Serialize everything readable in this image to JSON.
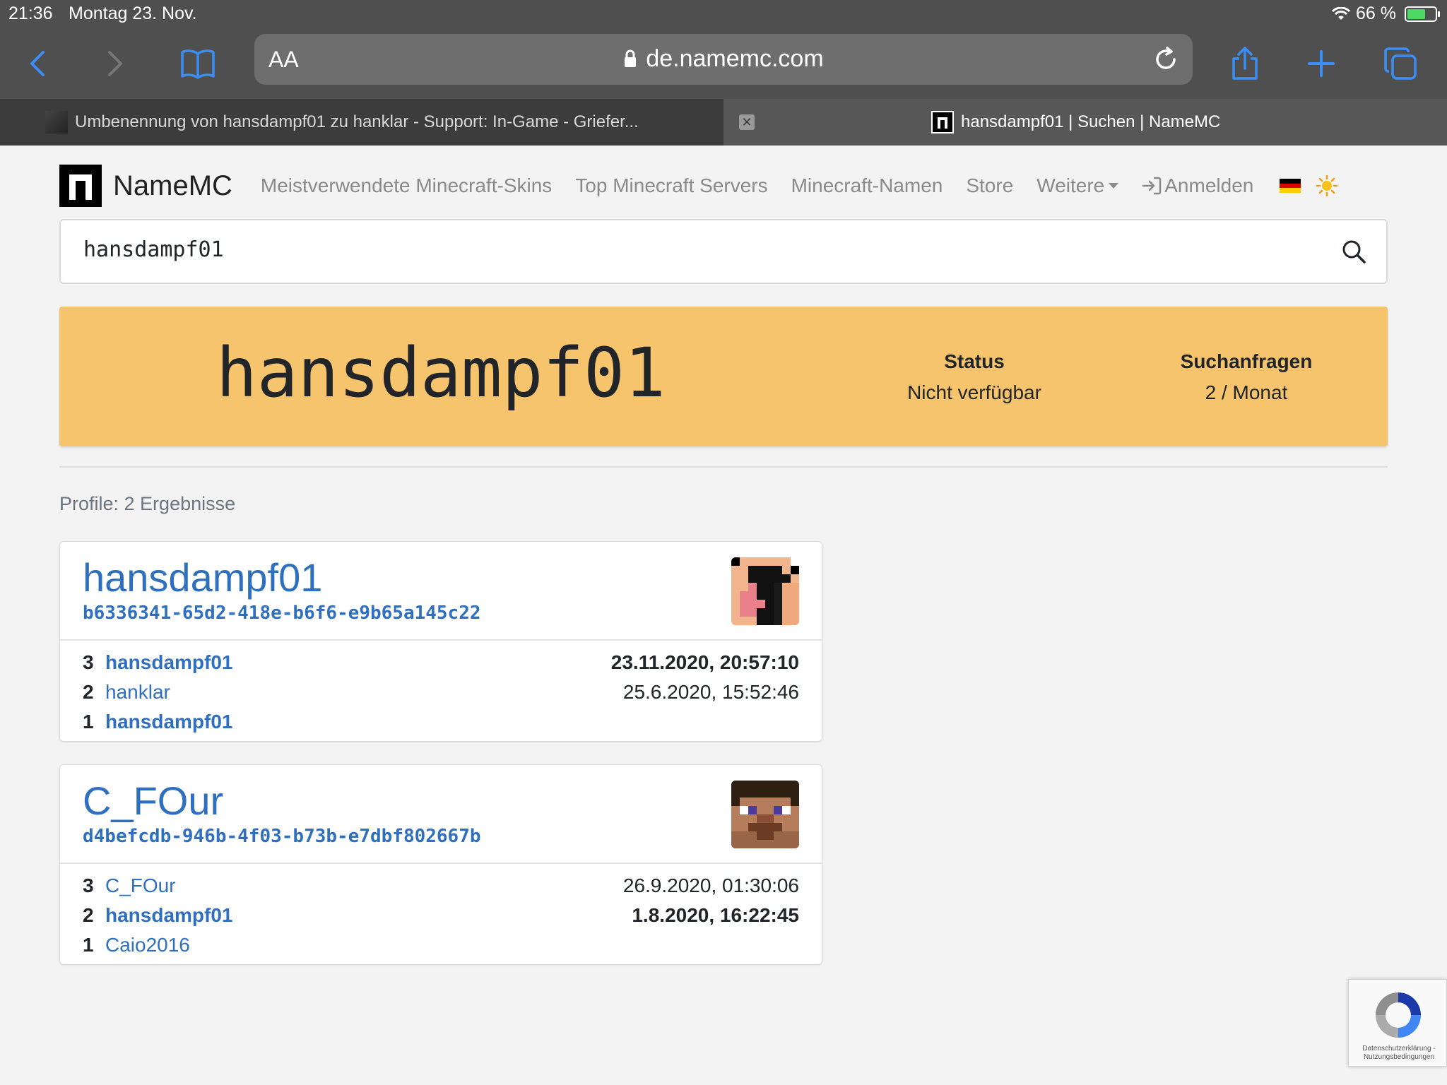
{
  "status_bar": {
    "time": "21:36",
    "date": "Montag 23. Nov.",
    "battery": "66 %"
  },
  "browser": {
    "text_size_label": "AA",
    "url": "de.namemc.com",
    "tabs": [
      {
        "title": "Umbenennung von hansdampf01 zu hanklar - Support: In-Game - Griefer..."
      },
      {
        "title": "hansdampf01 | Suchen | NameMC"
      }
    ]
  },
  "nav": {
    "brand": "NameMC",
    "links": [
      "Meistverwendete Minecraft-Skins",
      "Top Minecraft Servers",
      "Minecraft-Namen",
      "Store",
      "Weitere"
    ],
    "login": "Anmelden"
  },
  "search": {
    "value": "hansdampf01"
  },
  "hero": {
    "name": "hansdampf01",
    "status_label": "Status",
    "status_value": "Nicht verfügbar",
    "searches_label": "Suchanfragen",
    "searches_value": "2 / Monat",
    "color": "#f6c46c"
  },
  "results": {
    "count_text": "Profile: 2 Ergebnisse",
    "profiles": [
      {
        "name": "hansdampf01",
        "uuid": "b6336341-65d2-418e-b6f6-e9b65a145c22",
        "history": [
          {
            "num": "3",
            "name": "hansdampf01",
            "date": "23.11.2020, 20:57:10"
          },
          {
            "num": "2",
            "name": "hanklar",
            "date": "25.6.2020, 15:52:46"
          },
          {
            "num": "1",
            "name": "hansdampf01",
            "date": ""
          }
        ]
      },
      {
        "name": "C_FOur",
        "uuid": "d4befcdb-946b-4f03-b73b-e7dbf802667b",
        "history": [
          {
            "num": "3",
            "name": "C_FOur",
            "date": "26.9.2020, 01:30:06"
          },
          {
            "num": "2",
            "name": "hansdampf01",
            "date": "1.8.2020, 16:22:45"
          },
          {
            "num": "1",
            "name": "Caio2016",
            "date": ""
          }
        ]
      }
    ]
  },
  "recaptcha": {
    "text": "Datenschutzerklärung - Nutzungsbedingungen"
  },
  "colors": {
    "link": "#2f6fbf",
    "accent": "#f6c46c",
    "safari_blue": "#3a8ef6"
  }
}
